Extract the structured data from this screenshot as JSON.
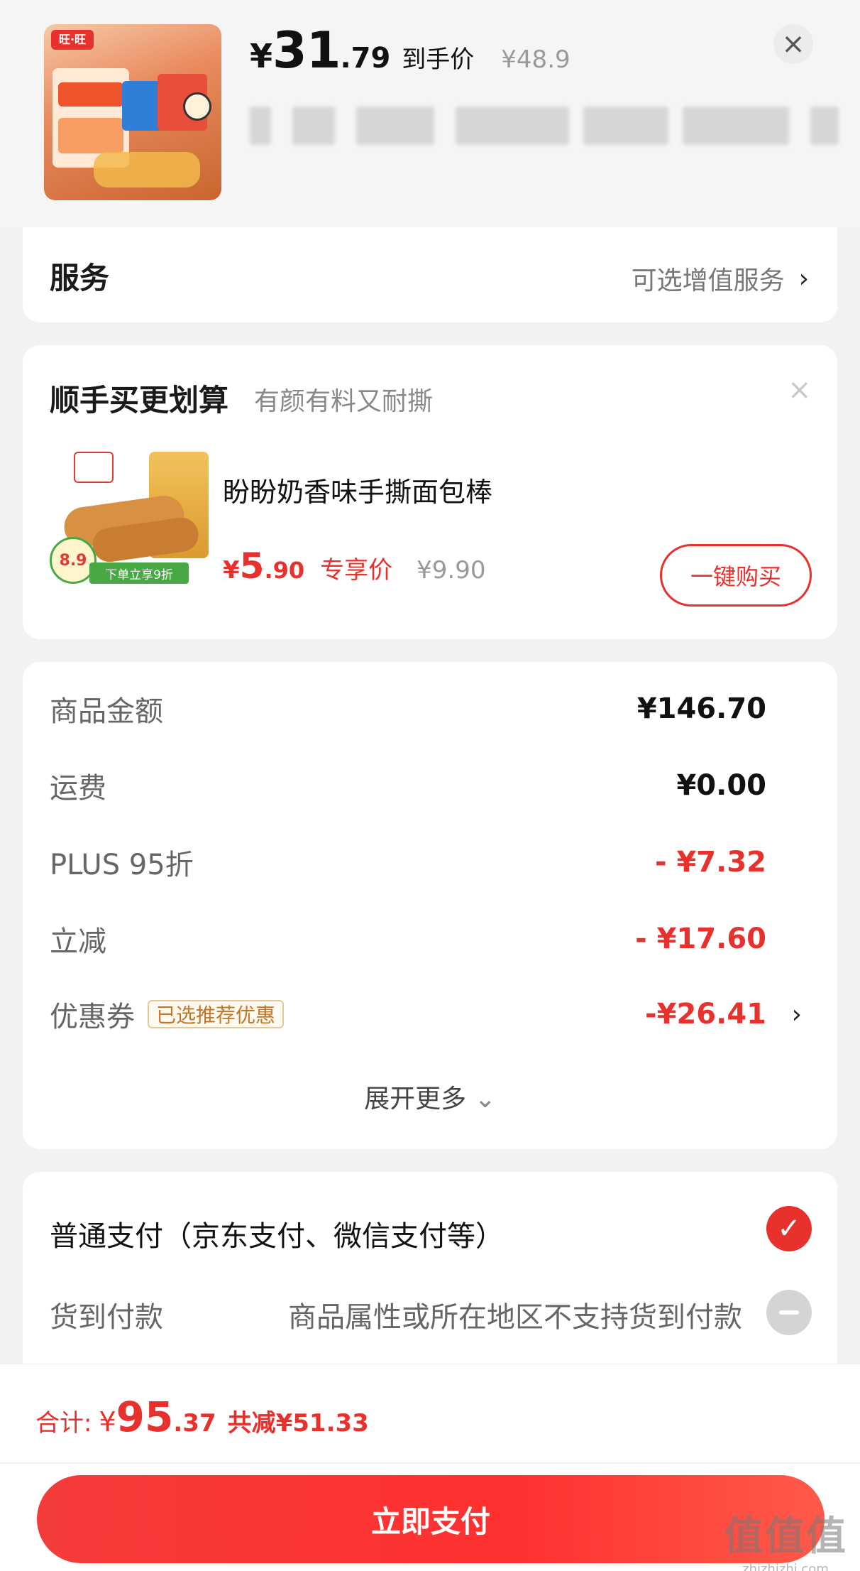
{
  "product": {
    "price_symbol": "¥",
    "price_int": "31",
    "price_dec": ".79",
    "price_tag": "到手价",
    "original_price": "¥48.9",
    "thumb_brand": "旺·旺"
  },
  "service": {
    "title": "服务",
    "right_label": "可选增值服务"
  },
  "upsell": {
    "title": "顺手买更划算",
    "subtitle": "有颜有料又耐撕",
    "item_name": "盼盼奶香味手撕面包棒",
    "price_symbol": "¥",
    "price_int": "5",
    "price_dec": ".90",
    "price_tag": "专享价",
    "original_price": "¥9.90",
    "buy_label": "一键购买",
    "badge_price": "8.9",
    "badge_text": "下单立享9折"
  },
  "summary": {
    "rows": [
      {
        "label": "商品金额",
        "value": "¥146.70"
      },
      {
        "label": "运费",
        "value": "¥0.00"
      },
      {
        "label": "PLUS 95折",
        "value": "- ¥7.32"
      },
      {
        "label": "立减",
        "value": "- ¥17.60"
      },
      {
        "label": "优惠券",
        "value": "-¥26.41",
        "tag": "已选推荐优惠"
      }
    ],
    "expand_label": "展开更多"
  },
  "payment": {
    "normal_label": "普通支付（京东支付、微信支付等）",
    "cod_label": "货到付款",
    "cod_note": "商品属性或所在地区不支持货到付款"
  },
  "bottom": {
    "total_label": "合计:",
    "total_symbol": "¥",
    "total_int": "95",
    "total_dec": ".37",
    "total_saved": "共减¥51.33",
    "pay_button": "立即支付"
  },
  "watermark": {
    "big": "值值值",
    "small": "zhizhizhi.com"
  },
  "colors": {
    "accent": "#e8302d",
    "background": "#f2f2f2",
    "coupon_tag": "#c2762a"
  }
}
